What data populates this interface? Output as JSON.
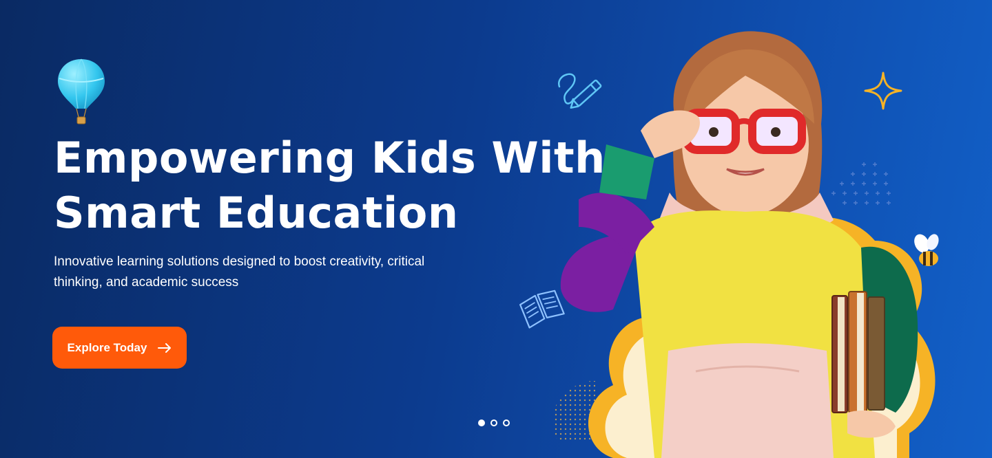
{
  "hero": {
    "title_line1": "Empowering Kids With",
    "title_line2": "Smart Education",
    "subtitle": "Innovative learning solutions designed to boost creativity, critical thinking, and academic success",
    "cta_label": "Explore Today"
  },
  "carousel": {
    "slides": 3,
    "active_index": 0
  },
  "icons": [
    "hot-air-balloon-icon",
    "pencil-doodle-icon",
    "open-book-icon",
    "sparkle-star-icon",
    "bee-icon",
    "arrow-right-icon"
  ],
  "colors": {
    "background_start": "#0a2a63",
    "background_end": "#1260c8",
    "cta": "#ff5a0a",
    "accent_yellow": "#f6b326",
    "doodle_blue": "#5fc6f5"
  }
}
